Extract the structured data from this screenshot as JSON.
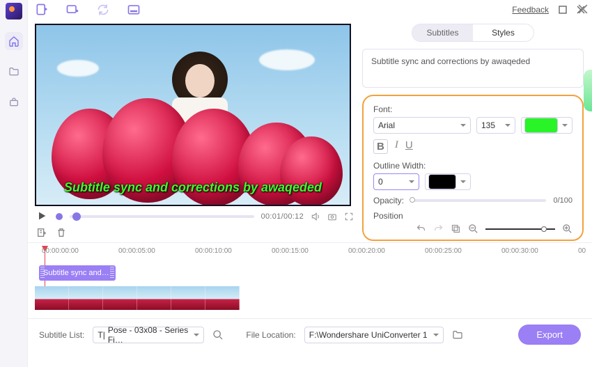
{
  "topbar": {
    "feedback": "Feedback"
  },
  "tabs": {
    "subtitles": "Subtitles",
    "styles": "Styles"
  },
  "subtitle_text": "Subtitle sync and corrections by awaqeded",
  "overlay_text": "Subtitle sync and corrections by awaqeded",
  "font": {
    "label": "Font:",
    "family": "Arial",
    "size": "135",
    "color_hex": "#28f428"
  },
  "outline": {
    "label": "Outline Width:",
    "value": "0",
    "color_hex": "#000000"
  },
  "opacity": {
    "label": "Opacity:",
    "display": "0/100"
  },
  "position": {
    "label": "Position"
  },
  "transport": {
    "time": "00:01/00:12"
  },
  "timeline": {
    "marks": [
      "00:00:00:00",
      "00:00:05:00",
      "00:00:10:00",
      "00:00:15:00",
      "00:00:20:00",
      "00:00:25:00",
      "00:00:30:00",
      "00"
    ],
    "sub_clip_label": "Subtitle sync and…"
  },
  "bottom": {
    "subtitle_list_label": "Subtitle List:",
    "subtitle_list_value": "Pose - 03x08 - Series Fi…",
    "file_location_label": "File Location:",
    "file_location_value": "F:\\Wondershare UniConverter 1",
    "export_label": "Export"
  }
}
